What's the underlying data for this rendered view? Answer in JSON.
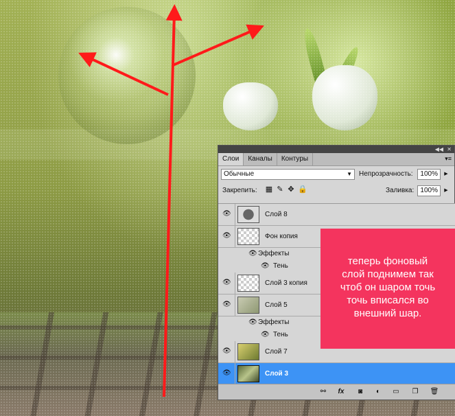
{
  "colors": {
    "accent_selected": "#3d93f5",
    "note_bg": "#f4345e",
    "arrow": "#ff1a1a"
  },
  "panel": {
    "tabs": [
      "Слои",
      "Каналы",
      "Контуры"
    ],
    "blend_mode": "Обычные",
    "opacity_label": "Непрозрачность:",
    "opacity_value": "100%",
    "lock_label": "Закрепить:",
    "fill_label": "Заливка:",
    "fill_value": "100%",
    "layers": [
      {
        "name": "Слой 8"
      },
      {
        "name": "Фон копия"
      },
      {
        "name": "Слой 3 копия"
      },
      {
        "name": "Слой 5"
      },
      {
        "name": "Слой 7"
      },
      {
        "name": "Слой 3"
      }
    ],
    "effects_label": "Эффекты",
    "shadow_label": "Тень",
    "bottom_icons": [
      "link-icon",
      "fx-icon",
      "mask-icon",
      "adjustment-icon",
      "folder-icon",
      "new-layer-icon",
      "trash-icon"
    ]
  },
  "note": {
    "lines": [
      "теперь фоновый",
      "слой поднимем так",
      "чтоб он шаром точь",
      "точь вписался во",
      "внешний шар."
    ]
  }
}
